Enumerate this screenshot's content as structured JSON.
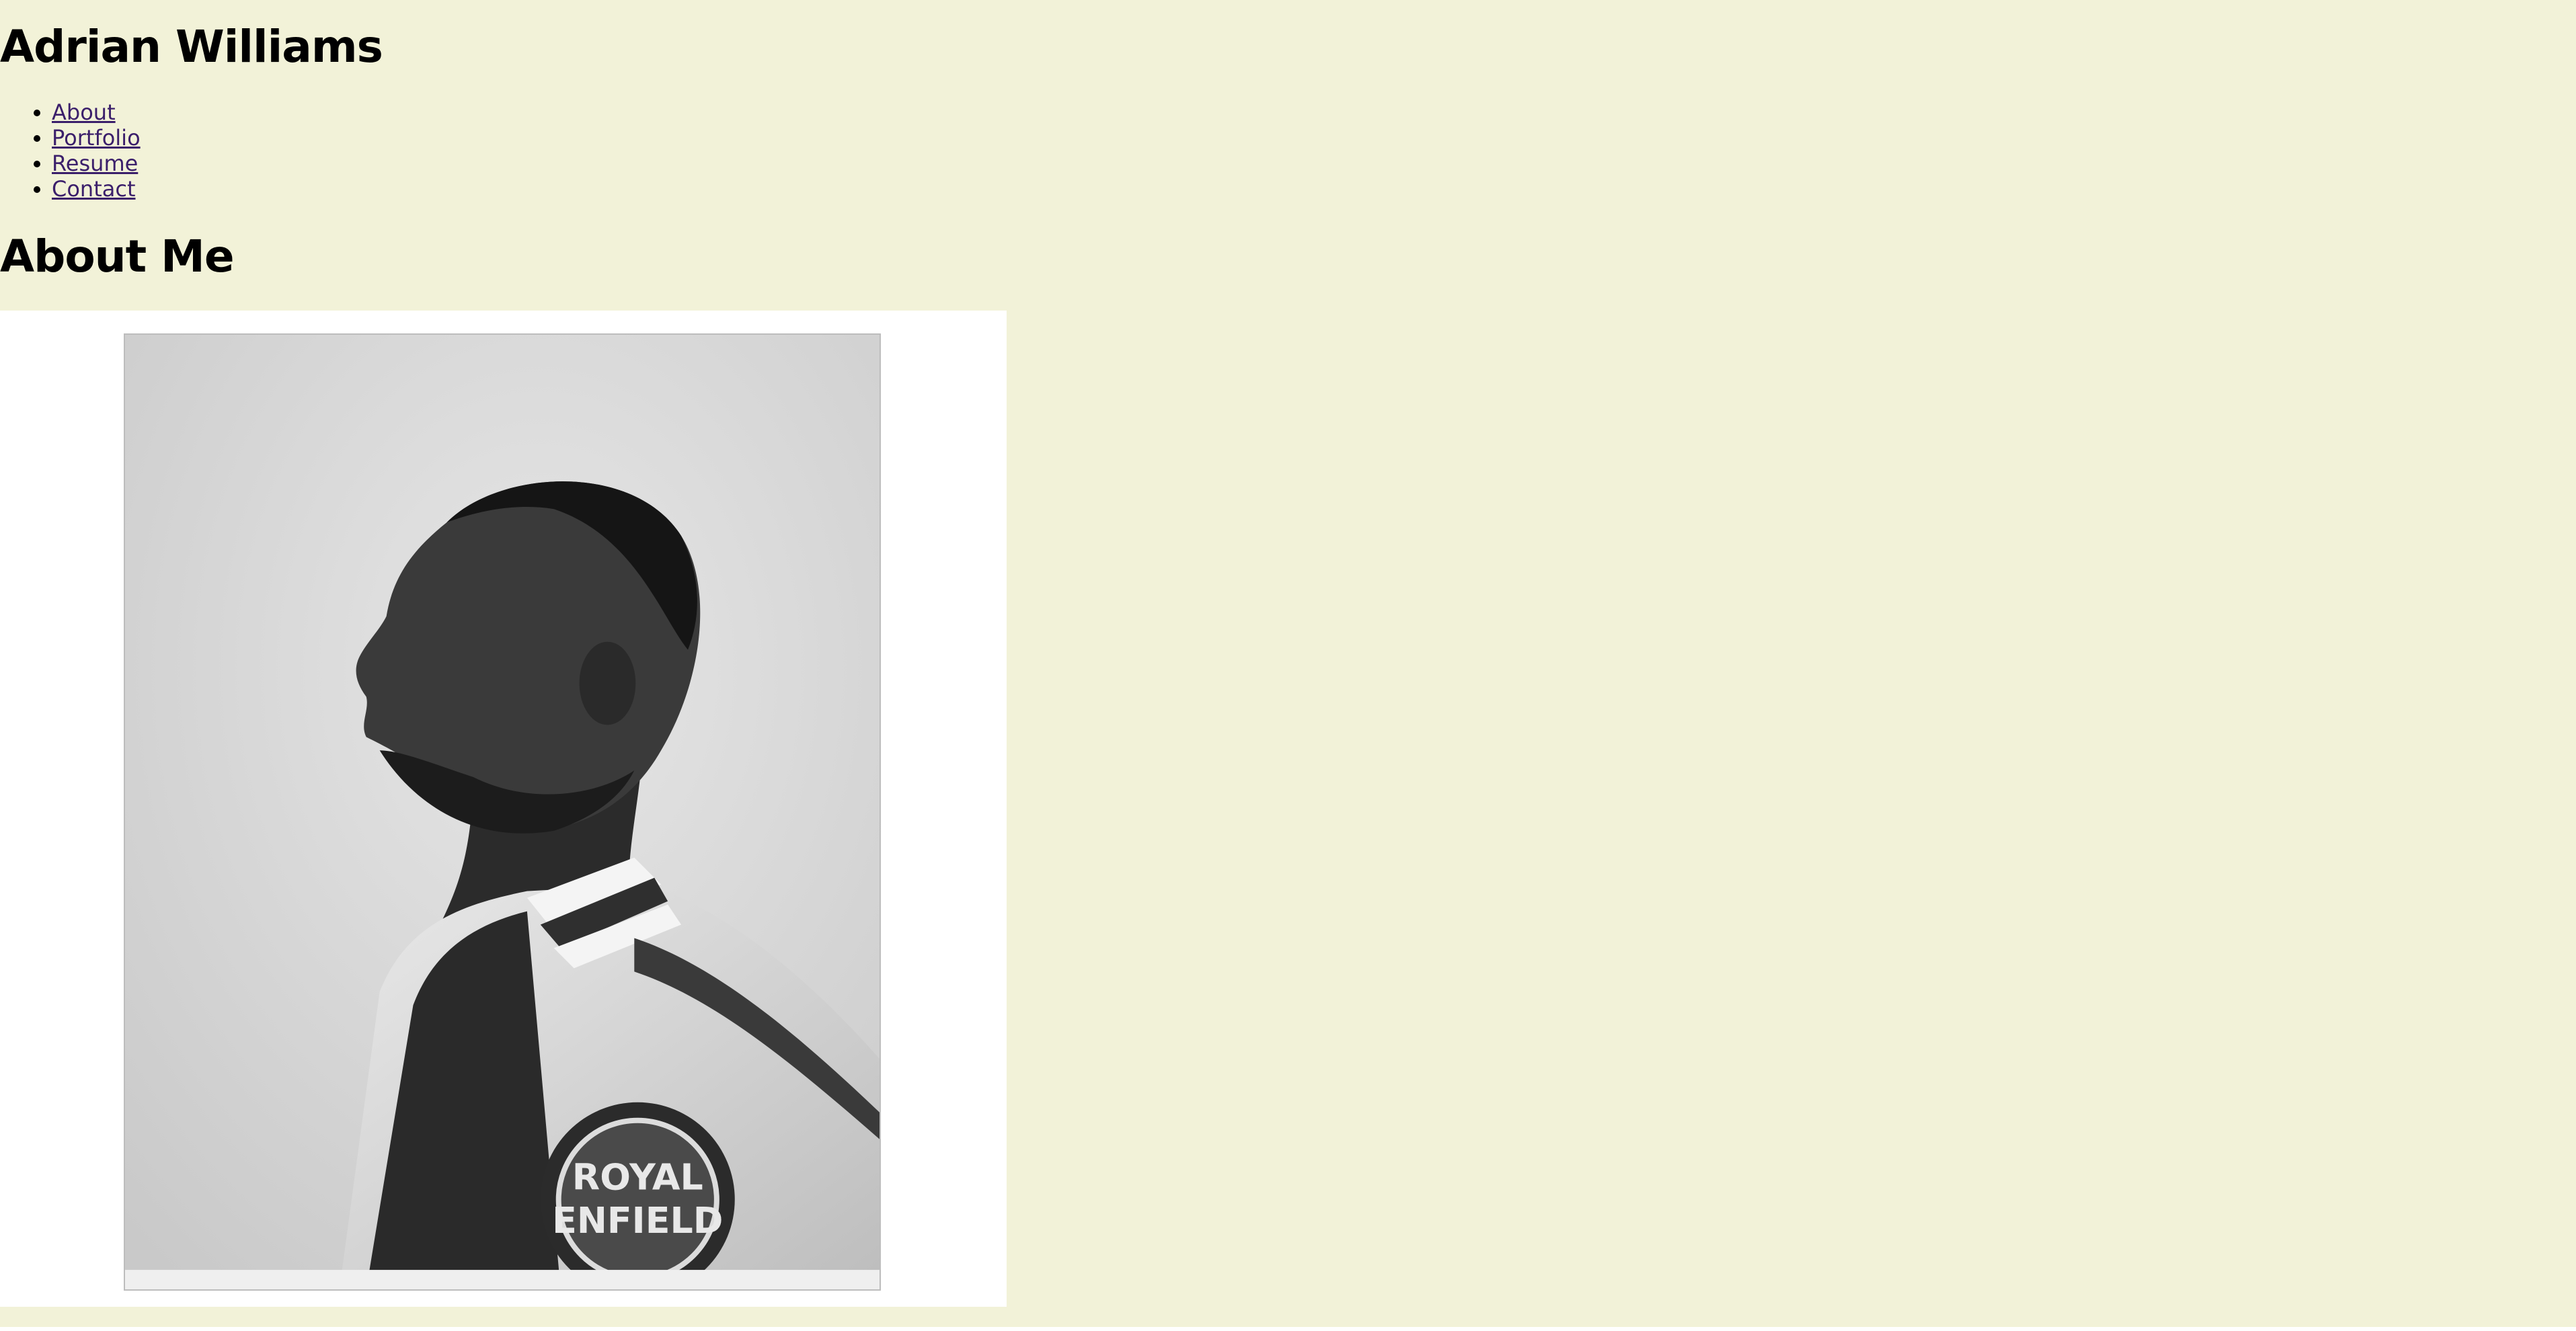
{
  "site": {
    "title": "Adrian Williams"
  },
  "nav": {
    "items": [
      {
        "label": "About"
      },
      {
        "label": "Portfolio"
      },
      {
        "label": "Resume"
      },
      {
        "label": "Contact"
      }
    ]
  },
  "main": {
    "section_title": "About Me",
    "photo": {
      "patch_text_line1": "ROYAL",
      "patch_text_line2": "ENFIELD"
    }
  },
  "colors": {
    "background": "#f2f2d8",
    "link": "#3b1f6b",
    "photo_frame": "#ffffff"
  }
}
